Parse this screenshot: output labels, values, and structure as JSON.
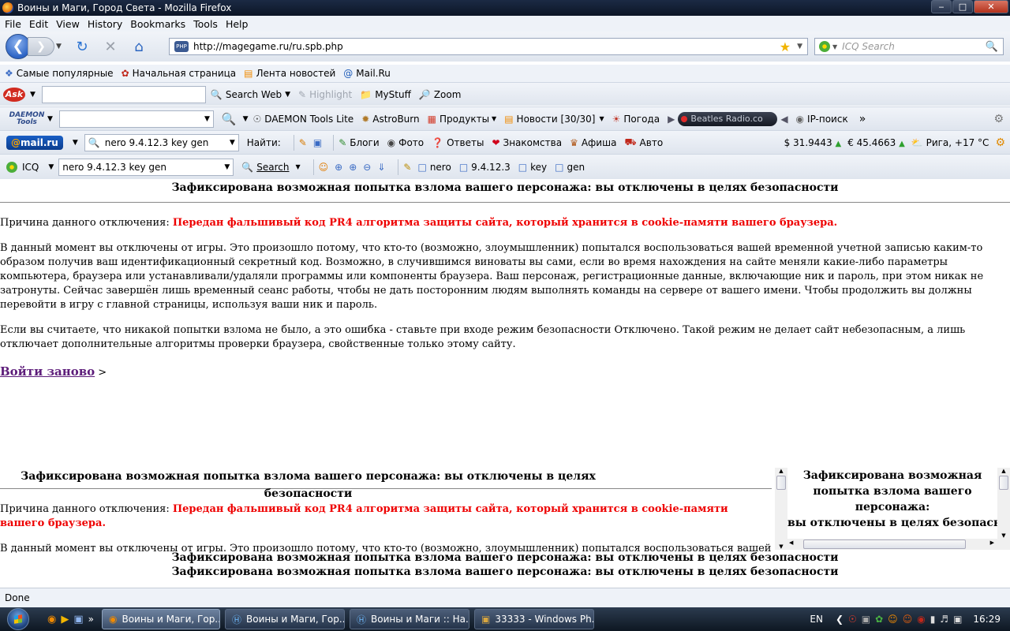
{
  "window": {
    "title": "Воины и Маги, Город Света - Mozilla Firefox",
    "controls": [
      "‒",
      "□",
      "✕"
    ]
  },
  "menu": [
    "File",
    "Edit",
    "View",
    "History",
    "Bookmarks",
    "Tools",
    "Help"
  ],
  "nav": {
    "url": "http://magegame.ru/ru.spb.php",
    "site_icon_label": "PHP",
    "search_placeholder": "ICQ Search"
  },
  "bookmarks": [
    {
      "label": "Самые популярные",
      "icon": "bookmark-icon"
    },
    {
      "label": "Начальная страница",
      "icon": "firefox-icon"
    },
    {
      "label": "Лента новостей",
      "icon": "rss-icon"
    },
    {
      "label": "Mail.Ru",
      "icon": "at-icon"
    }
  ],
  "ask_toolbar": {
    "logo": "Ask",
    "search_web": "Search Web",
    "highlight": "Highlight",
    "mystuff": "MyStuff",
    "zoom": "Zoom"
  },
  "daemon_toolbar": {
    "logo_line1": "DAEMON",
    "logo_line2": "Tools",
    "daemon_lite": "DAEMON Tools Lite",
    "astroburn": "AstroBurn",
    "products": "Продукты",
    "news": "Новости [30/30]",
    "weather": "Погода",
    "radio": "Beatles Radio.co",
    "ip_search": "IP-поиск"
  },
  "mailru_toolbar": {
    "logo_prefix": "@",
    "logo_text": "mail.ru",
    "query": "nero 9.4.12.3 key gen",
    "find": "Найти:",
    "blogs": "Блоги",
    "photo": "Фото",
    "answers": "Ответы",
    "dating": "Знакомства",
    "poster": "Афиша",
    "auto": "Авто",
    "usd": "$ 31.9443",
    "eur": "€ 45.4663",
    "weather": "Рига, +17 °C"
  },
  "icq_toolbar": {
    "logo": "ICQ",
    "query": "nero 9.4.12.3 key gen",
    "search": "Search",
    "terms": [
      "nero",
      "9.4.12.3",
      "key",
      "gen"
    ]
  },
  "page": {
    "headline": "Зафиксирована возможная попытка взлома вашего персонажа: вы отключены в целях безопасности",
    "reason_label": "Причина данного отключения:",
    "reason_text": "Передан фальшивый код PR4 алгоритма защиты сайта, который хранится в cookie-памяти вашего браузера.",
    "para1": "В данный момент вы отключены от игры. Это произошло потому, что кто-то (возможно, злоумышленник) попытался воспользоваться вашей временной учетной записью каким-то образом получив ваш идентификационный секретный код. Возможно, в случившимся виноваты вы сами, если во время нахождения на сайте меняли какие-либо параметры компьютера, браузера или устанавливали/удаляли программы или компоненты браузера. Ваш персонаж, регистрационные данные, включающие ник и пароль, при этом никак не затронуты. Сейчас завершён лишь временный сеанс работы, чтобы не дать посторонним людям выполнять команды на сервере от вашего имени. Чтобы продолжить вы должны перевойти в игру с главной страницы, используя ваши ник и пароль.",
    "para2": "Если вы считаете, что никакой попытки взлома не было, а это ошибка - ставьте при входе режим безопасности Отключено. Такой режим не делает сайт небезопасным, а лишь отключает дополнительные алгоритмы проверки браузера, свойственные только этому сайту.",
    "relogin": "Войти заново",
    "relogin_suffix": " >",
    "frame2_para_visible": "В данный момент вы отключены от игры. Это произошло потому, что кто-то (возможно, злоумышленник) попытался воспользоваться вашей временной учетной записью каким-то образом получив ваш идентификационный секретный код. Возможно, в случившимся виноваты вы сами, если во время",
    "frame3_line1": "Зафиксирована возможная",
    "frame3_line2": "попытка взлома вашего",
    "frame3_line3": "персонажа:",
    "frame3_line4": "вы отключены в целях безопасности"
  },
  "status": "Done",
  "taskbar": {
    "tasks": [
      {
        "label": "Воины и Маги, Гор...",
        "icon": "firefox-icon",
        "active": true
      },
      {
        "label": "Воины и Маги, Гор...",
        "icon": "ie-icon",
        "active": false
      },
      {
        "label": "Воины и Маги :: На...",
        "icon": "ie-icon",
        "active": false
      },
      {
        "label": "33333 - Windows Ph...",
        "icon": "photo-viewer-icon",
        "active": false
      }
    ],
    "lang": "EN",
    "clock": "16:29"
  }
}
